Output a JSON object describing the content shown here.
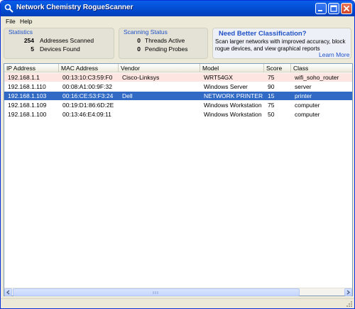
{
  "window": {
    "title": "Network Chemistry RogueScanner"
  },
  "menu": {
    "items": [
      "File",
      "Help"
    ]
  },
  "statistics": {
    "legend": "Statistics",
    "addresses_scanned_count": "254",
    "addresses_scanned_label": "Addresses Scanned",
    "devices_found_count": "5",
    "devices_found_label": "Devices Found"
  },
  "scanning_status": {
    "legend": "Scanning Status",
    "threads_active_count": "0",
    "threads_active_label": "Threads Active",
    "pending_probes_count": "0",
    "pending_probes_label": "Pending Probes"
  },
  "promo": {
    "title": "Need Better Classification?",
    "text": "Scan larger networks with improved accuracy,  block rogue devices, and view graphical reports",
    "link": "Learn More"
  },
  "table": {
    "columns": [
      "IP Address",
      "MAC Address",
      "Vendor",
      "Model",
      "Score",
      "Class"
    ],
    "rows": [
      {
        "ip": "192.168.1.1",
        "mac": "00:13:10:C3:59:F0",
        "vendor": "Cisco-Linksys",
        "model": "WRT54GX",
        "score": "75",
        "class": "wifi_soho_router",
        "state": "highlighted"
      },
      {
        "ip": "192.168.1.110",
        "mac": "00:08:A1:00:9F:32",
        "vendor": "",
        "model": "Windows Server",
        "score": "90",
        "class": "server",
        "state": "normal"
      },
      {
        "ip": "192.168.1.103",
        "mac": "00:16:CE:53:F3:24",
        "vendor": "Dell",
        "model": "NETWORK PRINTER",
        "score": "15",
        "class": "printer",
        "state": "selected"
      },
      {
        "ip": "192.168.1.109",
        "mac": "00:19:D1:86:6D:2E",
        "vendor": "",
        "model": "Windows Workstation",
        "score": "75",
        "class": "computer",
        "state": "normal"
      },
      {
        "ip": "192.168.1.100",
        "mac": "00:13:46:E4:09:11",
        "vendor": "",
        "model": "Windows Workstation",
        "score": "50",
        "class": "computer",
        "state": "normal"
      }
    ]
  },
  "colors": {
    "titlebar": "#0351d6",
    "selected_row": "#316ac5",
    "highlight_row": "#fde6e1",
    "accent_text": "#1f51c6"
  },
  "icons": [
    "app-icon",
    "minimize-icon",
    "maximize-icon",
    "close-icon",
    "scroll-left-icon",
    "scroll-right-icon",
    "size-grip-icon"
  ]
}
